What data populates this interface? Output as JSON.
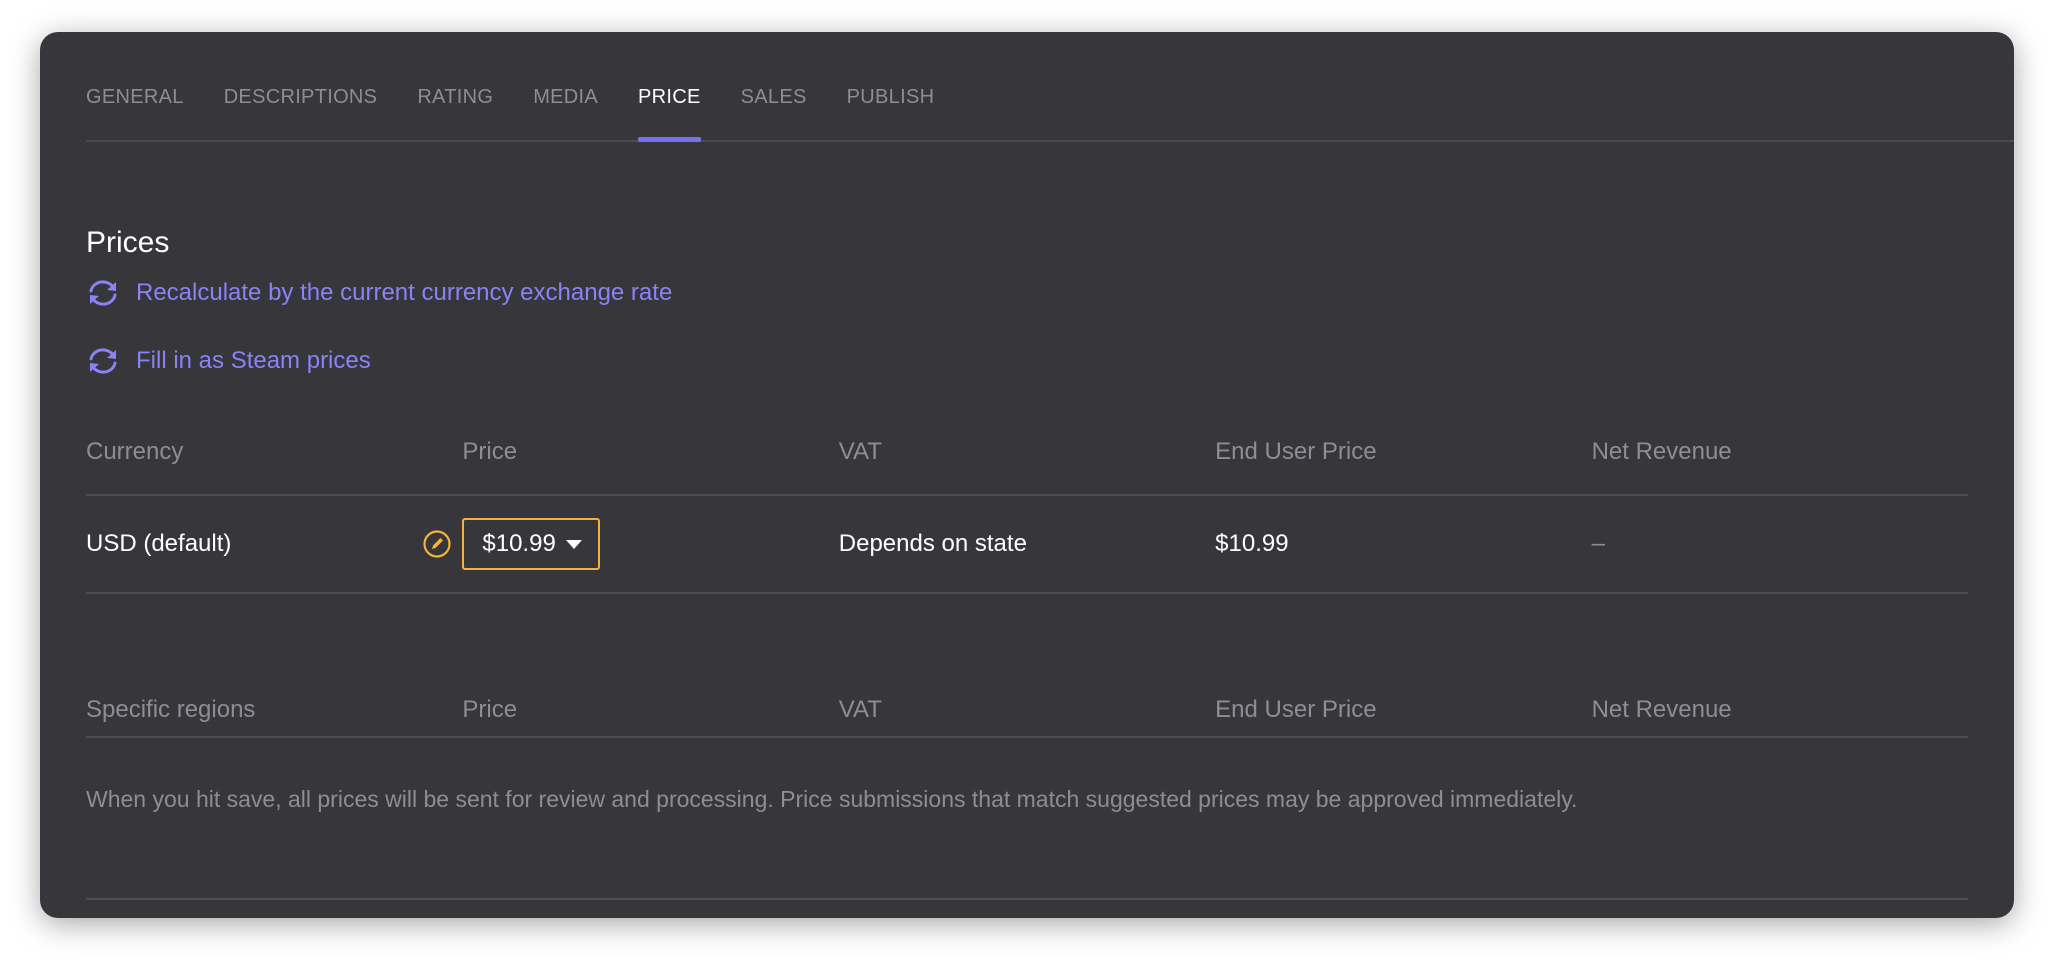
{
  "tabs": [
    {
      "label": "GENERAL"
    },
    {
      "label": "DESCRIPTIONS"
    },
    {
      "label": "RATING"
    },
    {
      "label": "MEDIA"
    },
    {
      "label": "PRICE",
      "active": true
    },
    {
      "label": "SALES"
    },
    {
      "label": "PUBLISH"
    }
  ],
  "section": {
    "title": "Prices",
    "actions": [
      {
        "label": "Recalculate by the current currency exchange rate",
        "icon": "refresh-icon"
      },
      {
        "label": "Fill in as Steam prices",
        "icon": "refresh-icon"
      }
    ]
  },
  "default_table": {
    "headers": [
      "Currency",
      "Price",
      "VAT",
      "End User Price",
      "Net Revenue"
    ],
    "rows": [
      {
        "currency": "USD (default)",
        "price": "$10.99",
        "vat": "Depends on state",
        "end_user_price": "$10.99",
        "net_revenue": "–"
      }
    ]
  },
  "regions_table": {
    "headers": [
      "Specific regions",
      "Price",
      "VAT",
      "End User Price",
      "Net Revenue"
    ]
  },
  "note": "When you hit save, all prices will be sent for review and processing. Price submissions that match suggested prices may be approved immediately.",
  "colors": {
    "background": "#36363b",
    "accent": "#7a6ff0",
    "link": "#8b82f5",
    "edit": "#f3b33c",
    "muted": "#8d8d94"
  }
}
